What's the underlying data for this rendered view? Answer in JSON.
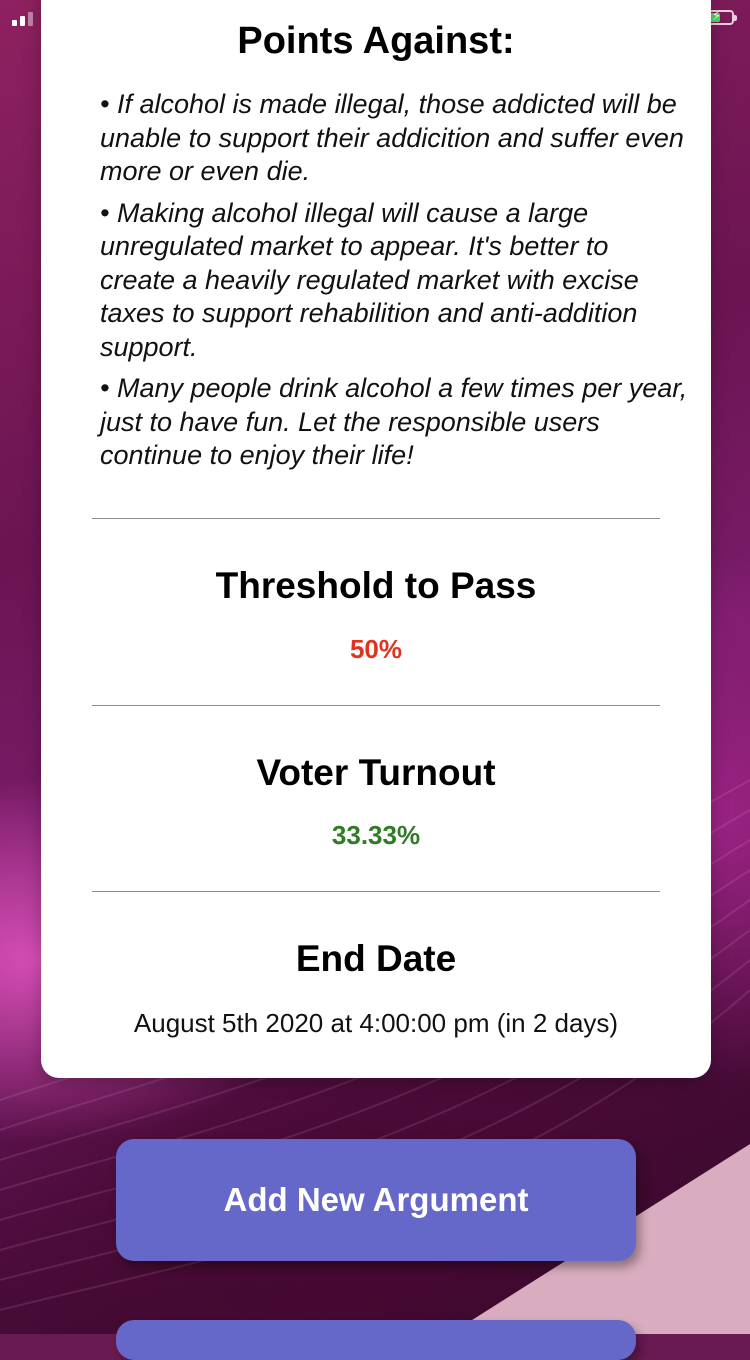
{
  "status_bar": {
    "signal_icon": "cellular-signal-icon",
    "battery_icon": "battery-charging-icon",
    "battery_color": "#4cd964"
  },
  "points_against": {
    "title": "Points Against:",
    "items": [
      "• If alcohol is made illegal, those addicted will be unable to support their addicition and suffer even more or even die.",
      "• Making alcohol illegal will cause a large unregulated market to appear. It's better to create a heavily regulated market with excise taxes to support rehabilition and anti-addition support.",
      "• Many people drink alcohol a few times per year, just to have fun. Let the responsible users continue to enjoy their life!"
    ]
  },
  "threshold": {
    "title": "Threshold to Pass",
    "value": "50%",
    "color": "#e0321f"
  },
  "turnout": {
    "title": "Voter Turnout",
    "value": "33.33%",
    "color": "#2e7d22"
  },
  "end_date": {
    "title": "End Date",
    "value": "August 5th 2020 at 4:00:00 pm (in 2 days)"
  },
  "actions": {
    "add_argument_label": "Add New Argument",
    "button_color": "#6568c9"
  }
}
